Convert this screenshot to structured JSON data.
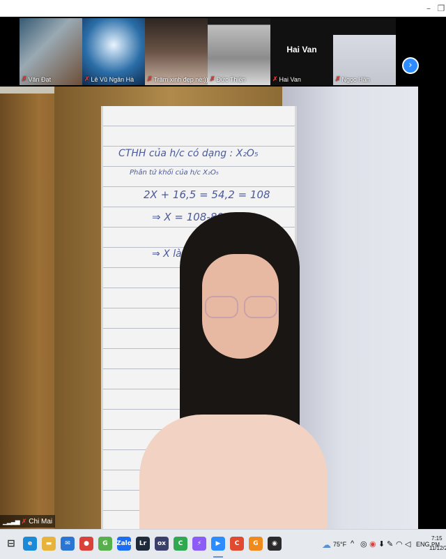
{
  "window": {
    "minimize_glyph": "–",
    "restore_glyph": "❐"
  },
  "gallery": {
    "participants": [
      {
        "name": "Văn Đạt",
        "muted": true
      },
      {
        "name": "Lê Vũ Ngân Hà",
        "muted": true
      },
      {
        "name": "Trâm xinh đẹp nè:)))",
        "muted": true
      },
      {
        "name": "Đức Thiện",
        "muted": true
      },
      {
        "name": "Hai Van",
        "muted": true,
        "display_name": "Hai Van"
      },
      {
        "name": "Ngọc Hân",
        "muted": true
      }
    ],
    "next_page_glyph": "›"
  },
  "main_video": {
    "speaker_name": "Chi Mai",
    "board_lines": [
      "CTHH của h/c có dạng : X₂O₅",
      "Phân tử khối của h/c X₂O₅",
      "2X + 16,5 = 54,2 = 108",
      "⇒ X = 108-80 = 14",
      "⇒ X là"
    ]
  },
  "taskbar": {
    "apps": [
      {
        "name": "task-view",
        "glyph": "⊟",
        "color": "#e6e9ee"
      },
      {
        "name": "edge",
        "glyph": "e",
        "color": "#1b8ad8"
      },
      {
        "name": "file-explorer",
        "glyph": "▬",
        "color": "#e8b33a"
      },
      {
        "name": "mail",
        "glyph": "✉",
        "color": "#2a76d2"
      },
      {
        "name": "chrome",
        "glyph": "●",
        "color": "#d9423a"
      },
      {
        "name": "coccoc",
        "glyph": "G",
        "color": "#58b04c"
      },
      {
        "name": "zalo",
        "glyph": "Zalo",
        "color": "#1b6ef3"
      },
      {
        "name": "lightroom",
        "glyph": "Lr",
        "color": "#1e2b3a"
      },
      {
        "name": "ox",
        "glyph": "ox",
        "color": "#3a3f6b"
      },
      {
        "name": "greenshot",
        "glyph": "C",
        "color": "#2fa84f"
      },
      {
        "name": "messenger",
        "glyph": "⚡",
        "color": "#8b5cf6"
      },
      {
        "name": "zoom",
        "glyph": "▶",
        "color": "#2d8cff"
      },
      {
        "name": "tool-red",
        "glyph": "C",
        "color": "#e04b2f"
      },
      {
        "name": "tool-orange",
        "glyph": "G",
        "color": "#f08a1c"
      },
      {
        "name": "tool-dark",
        "glyph": "◉",
        "color": "#2b2b2b"
      }
    ],
    "weather": "75°F",
    "language": "ENG",
    "time": "7:15 PM",
    "date": "11/12/20"
  }
}
